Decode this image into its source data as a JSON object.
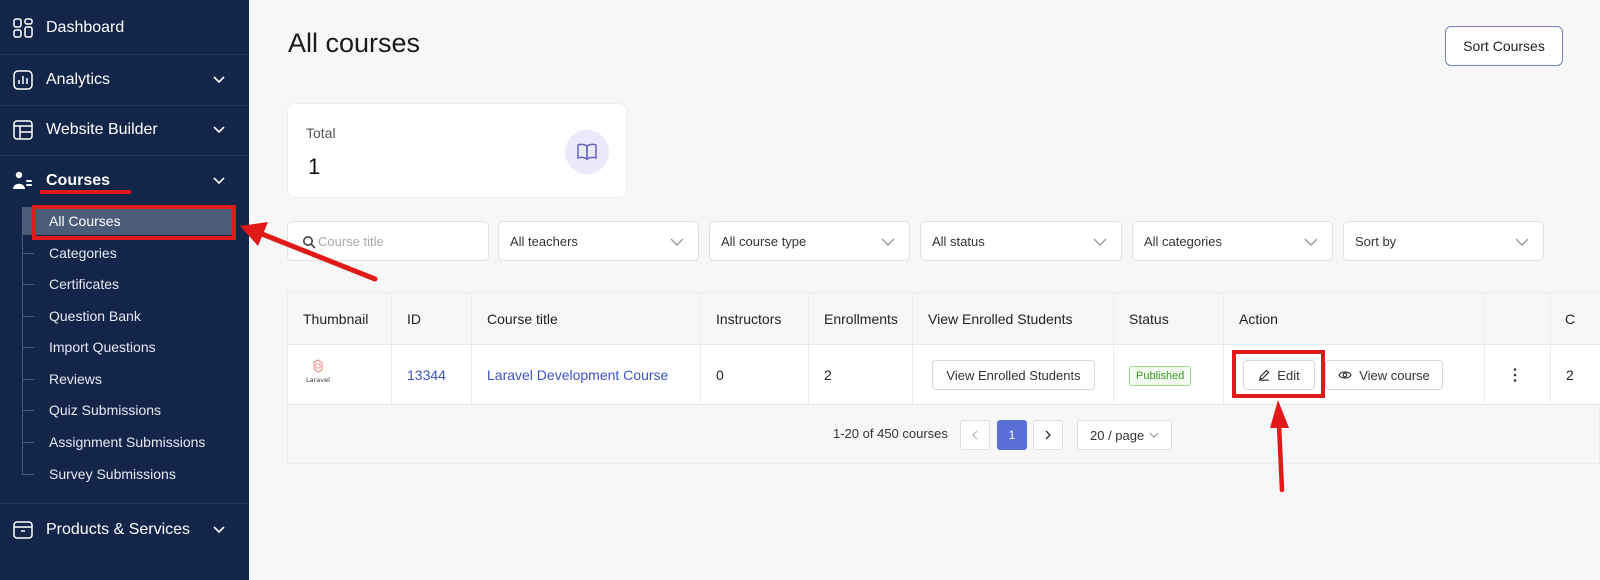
{
  "sidebar": {
    "items": [
      {
        "label": "Dashboard",
        "icon": "dashboard-icon"
      },
      {
        "label": "Analytics",
        "icon": "analytics-icon"
      },
      {
        "label": "Website Builder",
        "icon": "website-builder-icon"
      },
      {
        "label": "Courses",
        "icon": "courses-icon"
      },
      {
        "label": "Products & Services",
        "icon": "products-icon"
      }
    ],
    "course_subitems": [
      "All Courses",
      "Categories",
      "Certificates",
      "Question Bank",
      "Import Questions",
      "Reviews",
      "Quiz Submissions",
      "Assignment Submissions",
      "Survey Submissions"
    ]
  },
  "header": {
    "title": "All courses",
    "sort_button": "Sort Courses"
  },
  "stats": {
    "total_label": "Total",
    "total_value": "1"
  },
  "filters": {
    "search_placeholder": "Course title",
    "teachers": "All teachers",
    "course_type": "All course type",
    "status": "All status",
    "categories": "All categories",
    "sort": "Sort by"
  },
  "table": {
    "columns": [
      "Thumbnail",
      "ID",
      "Course title",
      "Instructors",
      "Enrollments",
      "View Enrolled Students",
      "Status",
      "Action",
      "",
      "C"
    ],
    "rows": [
      {
        "thumbnail_text": "Laravel",
        "id": "13344",
        "title": "Laravel Development Course",
        "instructors": "0",
        "enrollments": "2",
        "view_enrolled": "View Enrolled Students",
        "status": "Published",
        "edit": "Edit",
        "view_course": "View course",
        "extra": "2"
      }
    ]
  },
  "pagination": {
    "summary": "1-20 of 450 courses",
    "current_page": "1",
    "page_size": "20 / page"
  },
  "colors": {
    "sidebar_bg": "#13264a",
    "accent": "#5a6fd6",
    "link": "#3d53c4",
    "annotation": "#e01919",
    "status_published": "#3d9a29"
  }
}
